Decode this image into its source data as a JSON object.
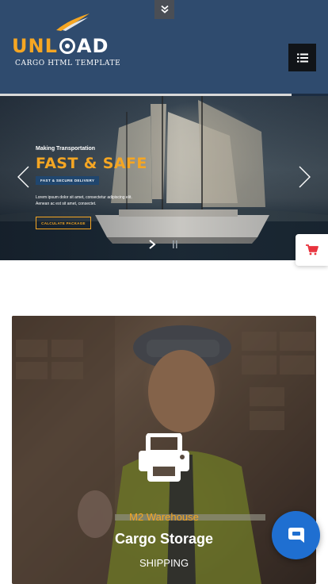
{
  "header": {
    "logo": {
      "text_part1": "UNL",
      "text_part2": "AD",
      "subtitle": "CARGO HTML TEMPLATE"
    },
    "top_toggle_icon": "chevron-double-down-icon",
    "menu_icon": "list-icon",
    "slide_progress_percent": 89
  },
  "hero": {
    "eyebrow": "Making Transportation",
    "title": "FAST & SAFE",
    "tag": "FAST & SECURE DELIVERY",
    "description": "Lorem ipsum dolor sit amet, consectetur adipiscing elit. Aenean ac est sit amet, consectet.",
    "cta_label": "CALCULATE PACKAGE",
    "controls": {
      "prev_icon": "chevron-left-icon",
      "next_icon": "chevron-right-icon",
      "play_icon": "play-icon",
      "pause_icon": "pause-icon"
    }
  },
  "cart": {
    "icon": "cart-icon"
  },
  "service_card": {
    "icon": "printer-icon",
    "subtitle": "M2 Warehouse",
    "title": "Cargo Storage",
    "link": "SHIPPING"
  },
  "chat": {
    "icon": "chat-bubble-icon"
  },
  "colors": {
    "header_bg": "#2f4b6e",
    "accent": "#f5a623",
    "tag_bg": "#20466e",
    "chat_bg": "#1f6fd1",
    "cart_red": "#e8323c"
  }
}
